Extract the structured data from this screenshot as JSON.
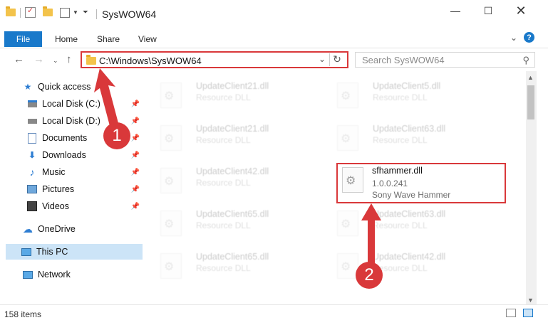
{
  "window": {
    "title": "SysWOW64"
  },
  "ribbon": {
    "tabs": [
      "File",
      "Home",
      "Share",
      "View"
    ]
  },
  "address": {
    "path": "C:\\Windows\\SysWOW64",
    "search_placeholder": "Search SysWOW64"
  },
  "nav": {
    "items": [
      {
        "label": "Quick access",
        "icon": "star-icon"
      },
      {
        "label": "Local Disk (C:)",
        "icon": "drive-icon",
        "pinned": true
      },
      {
        "label": "Local Disk (D:)",
        "icon": "drive-icon",
        "pinned": true
      },
      {
        "label": "Documents",
        "icon": "documents-icon",
        "pinned": true
      },
      {
        "label": "Downloads",
        "icon": "download-icon",
        "pinned": true
      },
      {
        "label": "Music",
        "icon": "music-icon",
        "pinned": true
      },
      {
        "label": "Pictures",
        "icon": "pictures-icon",
        "pinned": true
      },
      {
        "label": "Videos",
        "icon": "videos-icon",
        "pinned": true
      },
      {
        "label": "OneDrive",
        "icon": "cloud-icon"
      },
      {
        "label": "This PC",
        "icon": "computer-icon",
        "selected": true
      },
      {
        "label": "Network",
        "icon": "network-icon"
      }
    ]
  },
  "files": {
    "left": [
      {
        "name": "UpdateClient21.dll",
        "type": "Resource DLL"
      },
      {
        "name": "UpdateClient21.dll",
        "type": "Resource DLL"
      },
      {
        "name": "UpdateClient42.dll",
        "type": "Resource DLL"
      },
      {
        "name": "UpdateClient65.dll",
        "type": "Resource DLL"
      },
      {
        "name": "UpdateClient65.dll",
        "type": "Resource DLL"
      }
    ],
    "right": [
      {
        "name": "UpdateClient5.dll",
        "type": "Resource DLL"
      },
      {
        "name": "UpdateClient63.dll",
        "type": "Resource DLL"
      },
      {
        "name": "UpdateClient63.dll",
        "type": "Resource DLL"
      },
      {
        "name": "UpdateClient42.dll",
        "type": "Resource DLL"
      }
    ],
    "highlighted": {
      "name": "sfhammer.dll",
      "version": "1.0.0.241",
      "description": "Sony Wave Hammer"
    }
  },
  "annotations": {
    "step1": "1",
    "step2": "2",
    "accent": "#d9383a"
  },
  "status": {
    "items_count": "158 items"
  }
}
